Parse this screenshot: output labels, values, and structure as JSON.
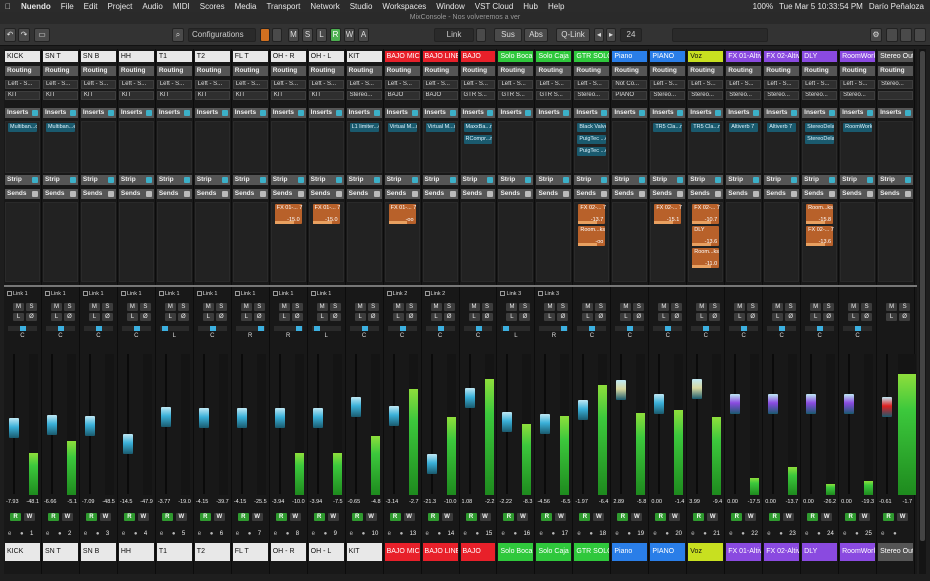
{
  "menubar": {
    "app": "Nuendo",
    "items": [
      "File",
      "Edit",
      "Project",
      "Audio",
      "MIDI",
      "Scores",
      "Media",
      "Transport",
      "Network",
      "Studio",
      "Workspaces",
      "Window",
      "VST Cloud",
      "Hub",
      "Help"
    ],
    "battery": "100%",
    "clock": "Tue Mar 5  10:33:54 PM",
    "user": "Darío Peñaloza"
  },
  "window": {
    "title": "MixConsole - Nos volveremos a ver"
  },
  "toolbar": {
    "configurations": "Configurations",
    "m": "M",
    "s": "S",
    "l": "L",
    "r": "R",
    "w": "W",
    "a": "A",
    "link": "Link",
    "sus": "Sus",
    "abs": "Abs",
    "qlink": "Q-Link",
    "channel_num": "24"
  },
  "labels": {
    "routing": "Routing",
    "inserts": "Inserts",
    "strip": "Strip",
    "sends": "Sends"
  },
  "channels": [
    {
      "name": "KICK",
      "color": "#e8e8e8",
      "in": "Left - S...",
      "out": "KIT",
      "inserts": [
        "Multiban...or"
      ],
      "sends": [],
      "link": "Link 1",
      "pan": "C",
      "vol": "-7.93",
      "peak": "-48.1",
      "num": "1",
      "meter": 0.3,
      "fader": 0.47
    },
    {
      "name": "SN T",
      "color": "#e8e8e8",
      "in": "Left - S...",
      "out": "KIT",
      "inserts": [
        "Multiban...er"
      ],
      "sends": [],
      "link": "Link 1",
      "pan": "C",
      "vol": "-6.66",
      "peak": "-5.1",
      "num": "2",
      "meter": 0.38,
      "fader": 0.49
    },
    {
      "name": "SN B",
      "color": "#e8e8e8",
      "in": "Left - S...",
      "out": "KIT",
      "inserts": [],
      "sends": [],
      "link": "Link 1",
      "pan": "C",
      "vol": "-7.09",
      "peak": "-48.5",
      "num": "3",
      "meter": 0.0,
      "fader": 0.48
    },
    {
      "name": "HH",
      "color": "#e8e8e8",
      "in": "Left - S...",
      "out": "KIT",
      "inserts": [],
      "sends": [],
      "link": "Link 1",
      "pan": "C",
      "vol": "-14.5",
      "peak": "-47.9",
      "num": "4",
      "meter": 0.0,
      "fader": 0.33
    },
    {
      "name": "T1",
      "color": "#e8e8e8",
      "in": "Left - S...",
      "out": "KIT",
      "inserts": [],
      "sends": [],
      "link": "Link 1",
      "pan": "L",
      "vol": "-3.77",
      "peak": "-19.0",
      "num": "5",
      "meter": 0.0,
      "fader": 0.56
    },
    {
      "name": "T2",
      "color": "#e8e8e8",
      "in": "Left - S...",
      "out": "KIT",
      "inserts": [],
      "sends": [],
      "link": "Link 1",
      "pan": "C",
      "vol": "-4.15",
      "peak": "-39.7",
      "num": "6",
      "meter": 0.0,
      "fader": 0.55
    },
    {
      "name": "FL T",
      "color": "#e8e8e8",
      "in": "Left - S...",
      "out": "KIT",
      "inserts": [],
      "sends": [],
      "link": "Link 1",
      "pan": "R",
      "vol": "-4.15",
      "peak": "-25.5",
      "num": "7",
      "meter": 0.0,
      "fader": 0.55
    },
    {
      "name": "OH - R",
      "color": "#e8e8e8",
      "in": "Left - S...",
      "out": "KIT",
      "inserts": [],
      "sends": [
        {
          "n": "FX 01-... 7",
          "v": "-15.0"
        }
      ],
      "link": "Link 1",
      "pan": "R",
      "vol": "-3.94",
      "peak": "-10.0",
      "num": "8",
      "meter": 0.3,
      "fader": 0.55
    },
    {
      "name": "OH - L",
      "color": "#e8e8e8",
      "in": "Left - S...",
      "out": "KIT",
      "inserts": [],
      "sends": [
        {
          "n": "FX 01-... 7",
          "v": "-15.0"
        }
      ],
      "link": "Link 1",
      "pan": "L",
      "vol": "-3.94",
      "peak": "-7.5",
      "num": "9",
      "meter": 0.3,
      "fader": 0.55
    },
    {
      "name": "KIT",
      "color": "#e8e8e8",
      "in": "Left - S...",
      "out": "Stereo...",
      "inserts": [
        "L1 limiter...eo"
      ],
      "sends": [],
      "link": "",
      "pan": "C",
      "vol": "-0.65",
      "peak": "-4.8",
      "num": "10",
      "meter": 0.42,
      "fader": 0.64
    },
    {
      "name": "BAJO MIC",
      "color": "#e8202a",
      "in": "Left - S...",
      "out": "BAJO",
      "inserts": [
        "Virtual M...ok"
      ],
      "sends": [
        {
          "n": "FX 01-... 7",
          "v": "-oo"
        }
      ],
      "link": "Link 2",
      "pan": "C",
      "vol": "-3.14",
      "peak": "-2.7",
      "num": "13",
      "meter": 0.75,
      "fader": 0.57
    },
    {
      "name": "BAJO LINE",
      "color": "#e8202a",
      "in": "Left - S...",
      "out": "BAJO",
      "inserts": [
        "Virtual M...ok"
      ],
      "sends": [],
      "link": "Link 2",
      "pan": "C",
      "vol": "-21.3",
      "peak": "-10.0",
      "num": "14",
      "meter": 0.55,
      "fader": 0.17
    },
    {
      "name": "BAJO",
      "color": "#e8202a",
      "in": "Left - S...",
      "out": "GTR S...",
      "inserts": [
        "MaxxBa...ro",
        "RCompr...ro"
      ],
      "sends": [],
      "link": "",
      "pan": "C",
      "vol": "1.08",
      "peak": "-2.2",
      "num": "15",
      "meter": 0.82,
      "fader": 0.72
    },
    {
      "name": "Solo Boca",
      "color": "#2fc83c",
      "in": "Left - S...",
      "out": "GTR S...",
      "inserts": [],
      "sends": [],
      "link": "Link 3",
      "pan": "L",
      "vol": "-2.22",
      "peak": "-8.3",
      "num": "16",
      "meter": 0.5,
      "fader": 0.52
    },
    {
      "name": "Solo Caja",
      "color": "#2fc83c",
      "in": "Left - S...",
      "out": "GTR S...",
      "inserts": [],
      "sends": [],
      "link": "Link 3",
      "pan": "R",
      "vol": "-4.56",
      "peak": "-6.5",
      "num": "17",
      "meter": 0.56,
      "fader": 0.5
    },
    {
      "name": "GTR SOLO",
      "color": "#2fc83c",
      "in": "Left - S...",
      "out": "Stereo...",
      "inserts": [
        "Black Valve",
        "PuigTec ...eo",
        "PuigTec ...eo"
      ],
      "sends": [
        {
          "n": "FX 02-... 7",
          "v": "-13.7"
        },
        {
          "n": "Room...ks",
          "v": "-oo"
        }
      ],
      "link": "",
      "pan": "C",
      "vol": "-1.97",
      "peak": "-6.4",
      "num": "18",
      "meter": 0.78,
      "fader": 0.62
    },
    {
      "name": "Piano",
      "color": "#2a7ee8",
      "in": "Not Co...",
      "out": "PIANO",
      "inserts": [],
      "sends": [],
      "link": "",
      "pan": "C",
      "vol": "2.89",
      "peak": "-5.8",
      "num": "19",
      "meter": 0.58,
      "fader": 0.78
    },
    {
      "name": "PIANO",
      "color": "#2a7ee8",
      "in": "Left - S...",
      "out": "Stereo...",
      "inserts": [
        "TR5 Cla...mp"
      ],
      "sends": [
        {
          "n": "FX 02-... 7",
          "v": "-15.1"
        }
      ],
      "link": "",
      "pan": "C",
      "vol": "0.00",
      "peak": "-1.4",
      "num": "20",
      "meter": 0.6,
      "fader": 0.67
    },
    {
      "name": "Voz",
      "color": "#c8e020",
      "in": "Left - S...",
      "out": "Stereo...",
      "inserts": [
        "TR5 Cla...mp"
      ],
      "sends": [
        {
          "n": "FX 02-... 7",
          "v": "-10.7"
        },
        {
          "n": "DLY",
          "v": "-13.6"
        },
        {
          "n": "Room...ks",
          "v": "-11.0"
        }
      ],
      "link": "",
      "pan": "C",
      "vol": "3.99",
      "peak": "-9.4",
      "num": "21",
      "meter": 0.55,
      "fader": 0.79
    },
    {
      "name": "FX 01-Altiverb 7",
      "color": "#8a4ae0",
      "in": "Left - S...",
      "out": "Stereo...",
      "inserts": [
        "Altiverb 7"
      ],
      "sends": [],
      "link": "",
      "pan": "C",
      "vol": "0.00",
      "peak": "-17.5",
      "num": "22",
      "meter": 0.12,
      "fader": 0.67
    },
    {
      "name": "FX 02-Altiverb 7",
      "color": "#8a4ae0",
      "in": "Left - S...",
      "out": "Stereo...",
      "inserts": [
        "Altiverb 7"
      ],
      "sends": [],
      "link": "",
      "pan": "C",
      "vol": "0.00",
      "peak": "-13.7",
      "num": "23",
      "meter": 0.2,
      "fader": 0.67
    },
    {
      "name": "DLY",
      "color": "#8a4ae0",
      "in": "Left - S...",
      "out": "Stereo...",
      "inserts": [
        "StereoDelay",
        "StereoDelay"
      ],
      "sends": [
        {
          "n": "Room...ks",
          "v": "-15.8"
        },
        {
          "n": "FX 02-... 7",
          "v": "-13.6"
        }
      ],
      "link": "",
      "pan": "C",
      "vol": "0.00",
      "peak": "-26.2",
      "num": "24",
      "meter": 0.08,
      "fader": 0.67
    },
    {
      "name": "RoomWorks",
      "color": "#8a4ae0",
      "in": "Left - S...",
      "out": "Stereo...",
      "inserts": [
        "RoomWorks"
      ],
      "sends": [],
      "link": "",
      "pan": "C",
      "vol": "0.00",
      "peak": "-19.3",
      "num": "25",
      "meter": 0.1,
      "fader": 0.67
    },
    {
      "name": "Stereo Out",
      "color": "#555555",
      "in": "Stereo...",
      "out": "",
      "inserts": [],
      "sends": [],
      "link": "",
      "pan": "",
      "vol": "-0.61",
      "peak": "-1.7",
      "num": "",
      "meter": 0.86,
      "fader": 0.64,
      "master": true
    }
  ]
}
